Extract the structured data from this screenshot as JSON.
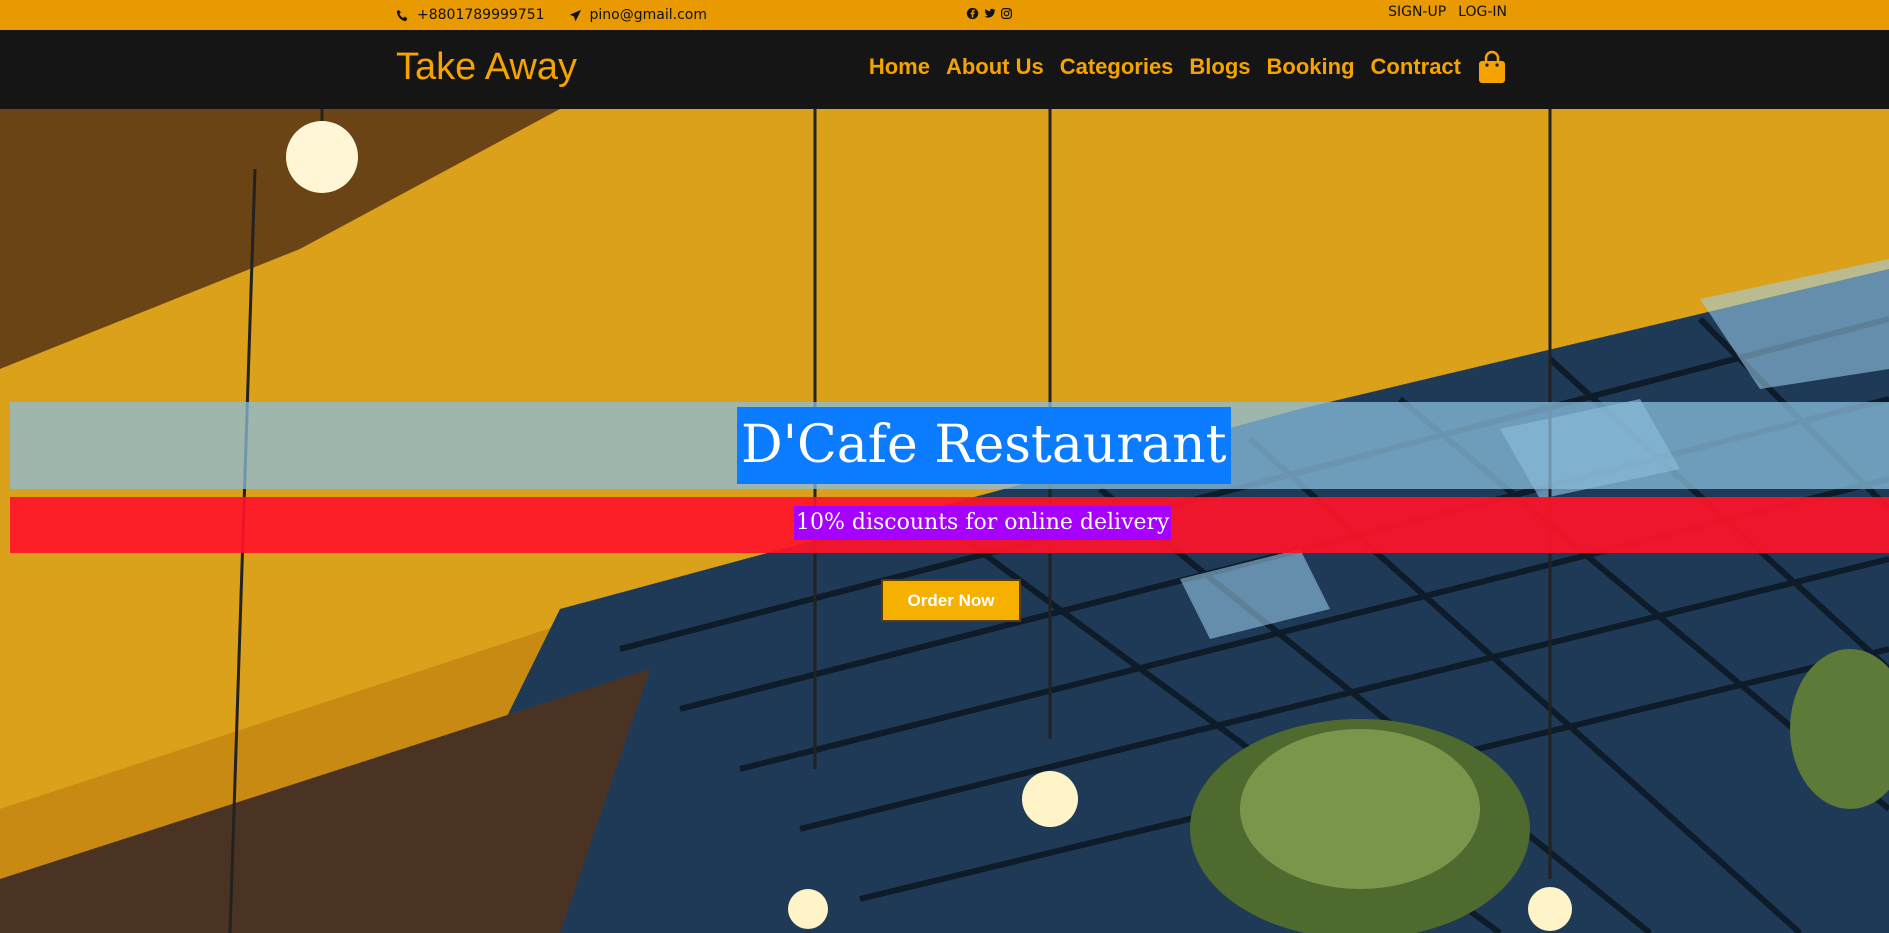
{
  "topbar": {
    "phone": "+8801789999751",
    "email": "pino@gmail.com",
    "social_icons": [
      "facebook-icon",
      "twitter-icon",
      "instagram-icon"
    ],
    "signup_label": "SIGN-UP",
    "login_label": "LOG-IN"
  },
  "navbar": {
    "brand": "Take Away",
    "links": [
      "Home",
      "About Us",
      "Categories",
      "Blogs",
      "Booking",
      "Contract"
    ],
    "cart_icon": "shopping-bag-icon"
  },
  "hero": {
    "title": "D'Cafe Restaurant",
    "discount_text": "10% discounts for online delivery",
    "cta_label": "Order Now"
  },
  "colors": {
    "accent": "#e89a00",
    "brand": "#f5a300",
    "nav_bg": "#151515",
    "title_bg": "#0b7bff",
    "discount_band": "#ff1428",
    "discount_bg": "#a600ff",
    "cta_bg": "#f5b000"
  }
}
